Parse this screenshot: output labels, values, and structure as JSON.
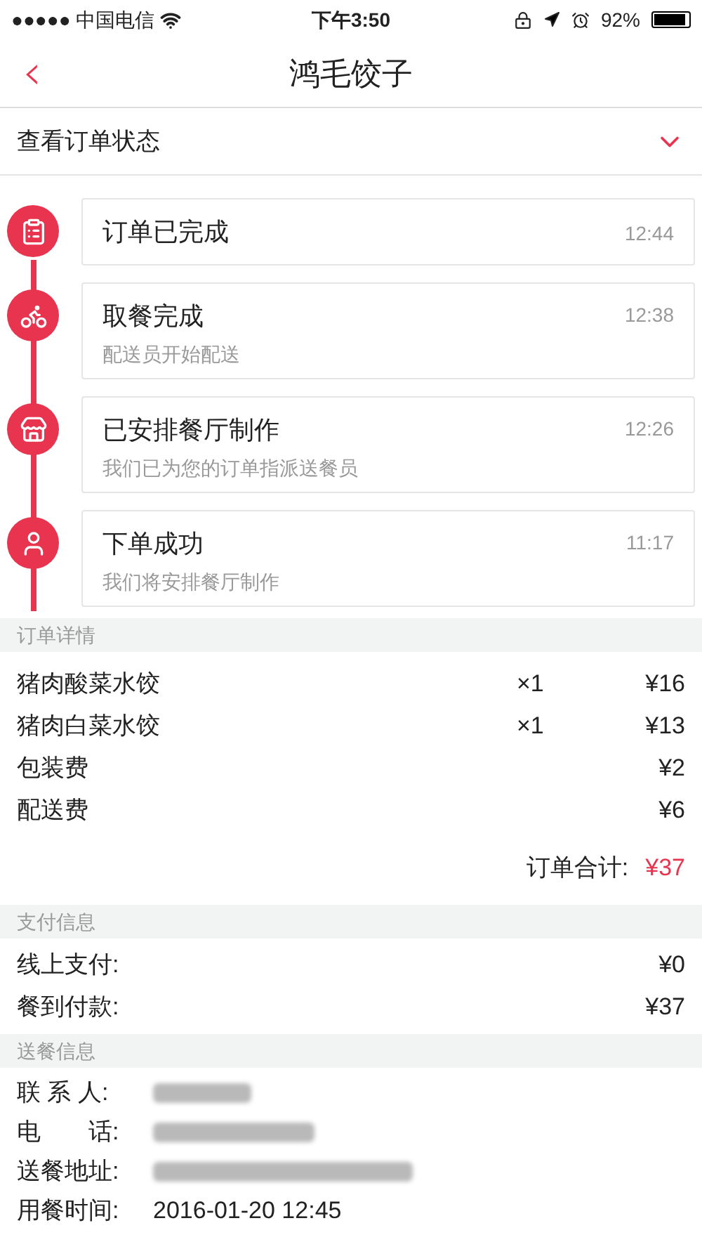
{
  "status_bar": {
    "carrier": "●●●●● 中国电信",
    "time": "下午3:50",
    "battery": "92%"
  },
  "nav": {
    "back": "‹",
    "title": "鸿毛饺子"
  },
  "order_status": {
    "label": "查看订单状态",
    "expanded": true
  },
  "timeline": [
    {
      "kind": "list",
      "title": "订单已完成",
      "time": "12:44"
    },
    {
      "kind": "scooter",
      "title": "取餐完成",
      "subtitle": "配送员开始配送",
      "time": "12:38"
    },
    {
      "kind": "shop",
      "title": "已安排餐厅制作",
      "subtitle": "我们已为您的订单指派送餐员",
      "time": "12:26"
    },
    {
      "kind": "person",
      "title": "下单成功",
      "subtitle": "我们将安排餐厅制作",
      "time": "11:17"
    }
  ],
  "order_details": {
    "header": "订单详情",
    "items": [
      {
        "name": "猪肉酸菜水饺",
        "qty": "×1",
        "price": "¥16"
      },
      {
        "name": "猪肉白菜水饺",
        "qty": "×1",
        "price": "¥13"
      },
      {
        "name": "包装费",
        "price": "¥2"
      },
      {
        "name": "配送费",
        "price": "¥6"
      }
    ],
    "total_label": "订单合计:",
    "total": "¥37"
  },
  "payment": {
    "header": "支付信息",
    "rows": [
      {
        "label": "线上支付:",
        "value": "¥0"
      },
      {
        "label": "餐到付款:",
        "value": "¥37"
      }
    ]
  },
  "delivery": {
    "header": "送餐信息",
    "rows": [
      {
        "label": "联 系 人:",
        "kind": "blurred"
      },
      {
        "label": "电　　话:",
        "kind": "blurred"
      },
      {
        "label": "送餐地址:",
        "kind": "blurred"
      },
      {
        "label": "用餐时间:",
        "kind": "text",
        "value": "2016-01-20 12:45"
      }
    ]
  }
}
